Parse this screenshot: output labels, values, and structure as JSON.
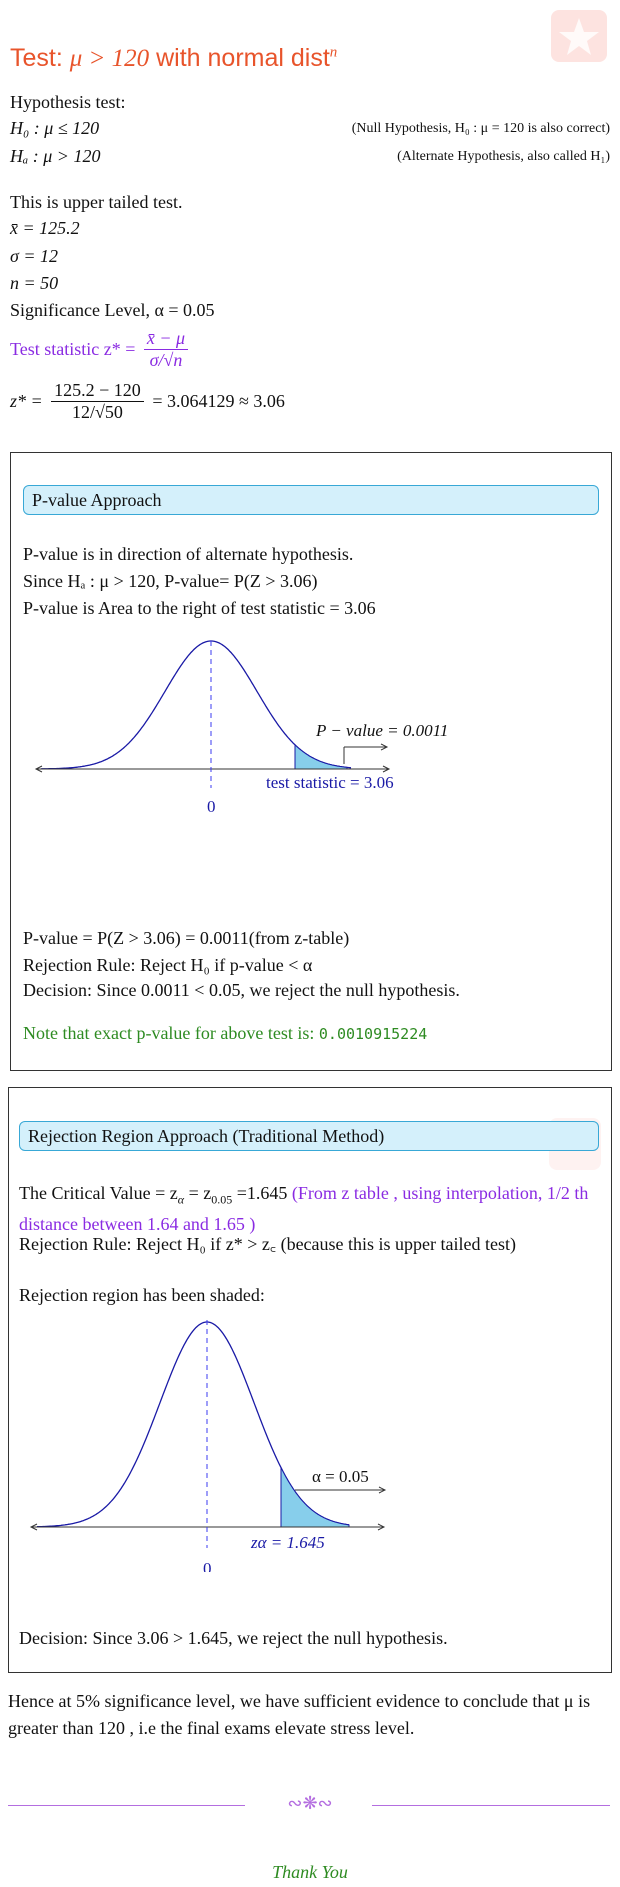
{
  "title": {
    "prefix": "Test: ",
    "math": "μ > 120",
    "suffix": " with normal dist",
    "sup": "n"
  },
  "hypothesis": {
    "heading": "Hypothesis test:",
    "h0": "H₀ : μ ≤ 120",
    "h0_note": "(Null Hypothesis, H₀ : μ = 120 is also correct)",
    "ha": "Hₐ : μ > 120",
    "ha_note": "(Alternate Hypothesis, also called H₁)"
  },
  "given": {
    "tail": "This is upper tailed test.",
    "xbar": "x̄ = 125.2",
    "sigma": "σ = 12",
    "n": "n = 50",
    "alpha": "Significance Level, α = 0.05"
  },
  "test_stat": {
    "label": "Test statistic z* =",
    "num": "x̄ − μ",
    "den": "σ/√n",
    "calc_lhs": "z* =",
    "calc_num": "125.2 − 120",
    "calc_den": "12/√50",
    "calc_rhs": "= 3.064129 ≈ 3.06"
  },
  "pvalue_box": {
    "banner": "P-value Approach",
    "line1": "P-value is in direction of alternate hypothesis.",
    "line2": "Since Hₐ : μ > 120, P-value= P(Z > 3.06)",
    "line3": "P-value is Area to the right of test statistic = 3.06",
    "curve_label": "P − value = 0.0011",
    "axis_label": "test statistic = 3.06",
    "zero": "0",
    "result": "P-value = P(Z > 3.06) = 0.0011(from z-table)",
    "rule": "Rejection Rule: Reject H₀ if p-value < α",
    "decision": "Decision: Since 0.0011 < 0.05, we reject the null hypothesis.",
    "exact_text": "Note that exact p-value for above test is: ",
    "exact_value": "0.0010915224"
  },
  "rejection_box": {
    "banner": "Rejection Region Approach (Traditional Method)",
    "critical_a": "The Critical Value = z",
    "critical_b": "=1.645",
    "critical_note": "(From z table , using interpolation, 1/2 th distance between 1.64 and 1.65 )",
    "rule": "Rejection Rule: Reject H₀ if z* > z꜀ (because this is upper tailed test)",
    "shaded": "Rejection region has been shaded:",
    "alpha_label": "α = 0.05",
    "z_label": "zα = 1.645",
    "zero": "0",
    "decision": "Decision: Since 3.06 > 1.645, we reject the null hypothesis."
  },
  "conclusion": "Hence at 5% significance level, we have sufficient evidence to conclude that μ is greater than 120 , i.e the final exams elevate stress level.",
  "footer": {
    "ornament": "∾❋∾",
    "thanks": "Thank You"
  },
  "colors": {
    "title": "#e8542b",
    "purple": "#8a2be2",
    "curve": "#1a1aa6",
    "shade": "#87ceeb",
    "banner_bg": "#d4f0fb",
    "green": "#2e8b22"
  }
}
